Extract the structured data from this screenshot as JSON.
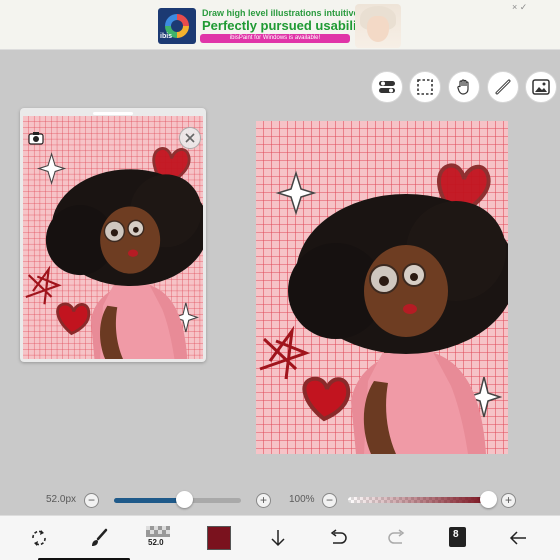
{
  "ad": {
    "app_logo_label": "ibis",
    "line1": "Draw high level illustrations intuitively!",
    "line2": "Perfectly pursued usability!",
    "line3": "ibisPaint for Windows is available!",
    "close_label": "× ✓"
  },
  "tool_buttons": [
    {
      "name": "toggle-switch-icon"
    },
    {
      "name": "selection-rectangle-icon"
    },
    {
      "name": "hand-move-icon"
    },
    {
      "name": "ruler-icon"
    },
    {
      "name": "reference-image-icon"
    }
  ],
  "reference_panel": {
    "camera_icon": "camera-icon",
    "close_icon": "close-icon"
  },
  "sliders": {
    "brush_size_label": "52.0px",
    "brush_size_value": 0.55,
    "opacity_label": "100%",
    "opacity_value": 1.0
  },
  "toolbar": {
    "brush_size_text": "52.0",
    "current_color": "#7a121e",
    "layer_count": "8"
  },
  "colors": {
    "canvas_background": "#f4b8bd",
    "grid_line": "#e03b4b",
    "accent_blue": "#1f5a8a"
  }
}
